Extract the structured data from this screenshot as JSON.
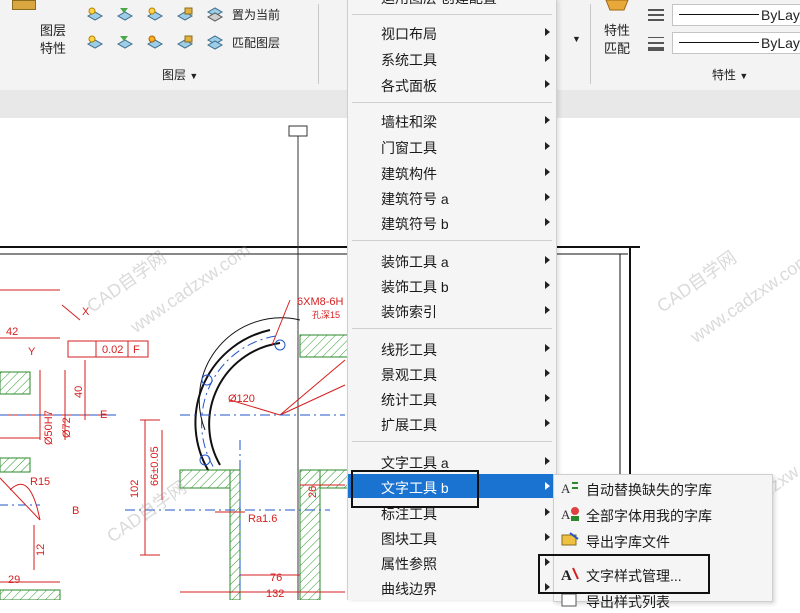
{
  "ribbon": {
    "layer_props_label": [
      "图层",
      "特性"
    ],
    "set_current_label": "置为当前",
    "match_layer_label": "匹配图层",
    "layers_panel_label": "图层",
    "props_panel_label": "特性",
    "match_props_label": [
      "特性",
      "匹配"
    ],
    "bylayer_1": "ByLay",
    "bylayer_2": "ByLay",
    "top_partial_text": "运用图层 创建配置"
  },
  "menu": {
    "items": [
      {
        "label": "视口布局"
      },
      {
        "label": "系统工具"
      },
      {
        "label": "各式面板"
      },
      {
        "label": "墙柱和梁"
      },
      {
        "label": "门窗工具"
      },
      {
        "label": "建筑构件"
      },
      {
        "label": "建筑符号 a"
      },
      {
        "label": "建筑符号 b"
      },
      {
        "label": "装饰工具 a"
      },
      {
        "label": "装饰工具 b"
      },
      {
        "label": "装饰索引"
      },
      {
        "label": "线形工具"
      },
      {
        "label": "景观工具"
      },
      {
        "label": "统计工具"
      },
      {
        "label": "扩展工具"
      },
      {
        "label": "文字工具 a"
      },
      {
        "label": "文字工具 b"
      },
      {
        "label": "标注工具"
      },
      {
        "label": "图块工具"
      },
      {
        "label": "属性参照"
      },
      {
        "label": "曲线边界"
      }
    ]
  },
  "submenu": {
    "items": [
      {
        "label": "自动替换缺失的字库"
      },
      {
        "label": "全部字体用我的字库"
      },
      {
        "label": "导出字库文件"
      },
      {
        "label": "文字样式管理..."
      },
      {
        "label": "导出样式列表"
      }
    ]
  },
  "drawing": {
    "dims": [
      "42",
      "X",
      "Y",
      "0.02",
      "F",
      "40",
      "E",
      "Ø50H7",
      "Ø72",
      "Ø120",
      "B",
      "R15",
      "102",
      "66±0.05",
      "Ra1.6",
      "26",
      "76",
      "132",
      "29",
      "12",
      "6XM8-6H",
      "孔深15"
    ]
  },
  "watermarks": [
    "CAD自学网",
    "www.cadzxw.com"
  ]
}
